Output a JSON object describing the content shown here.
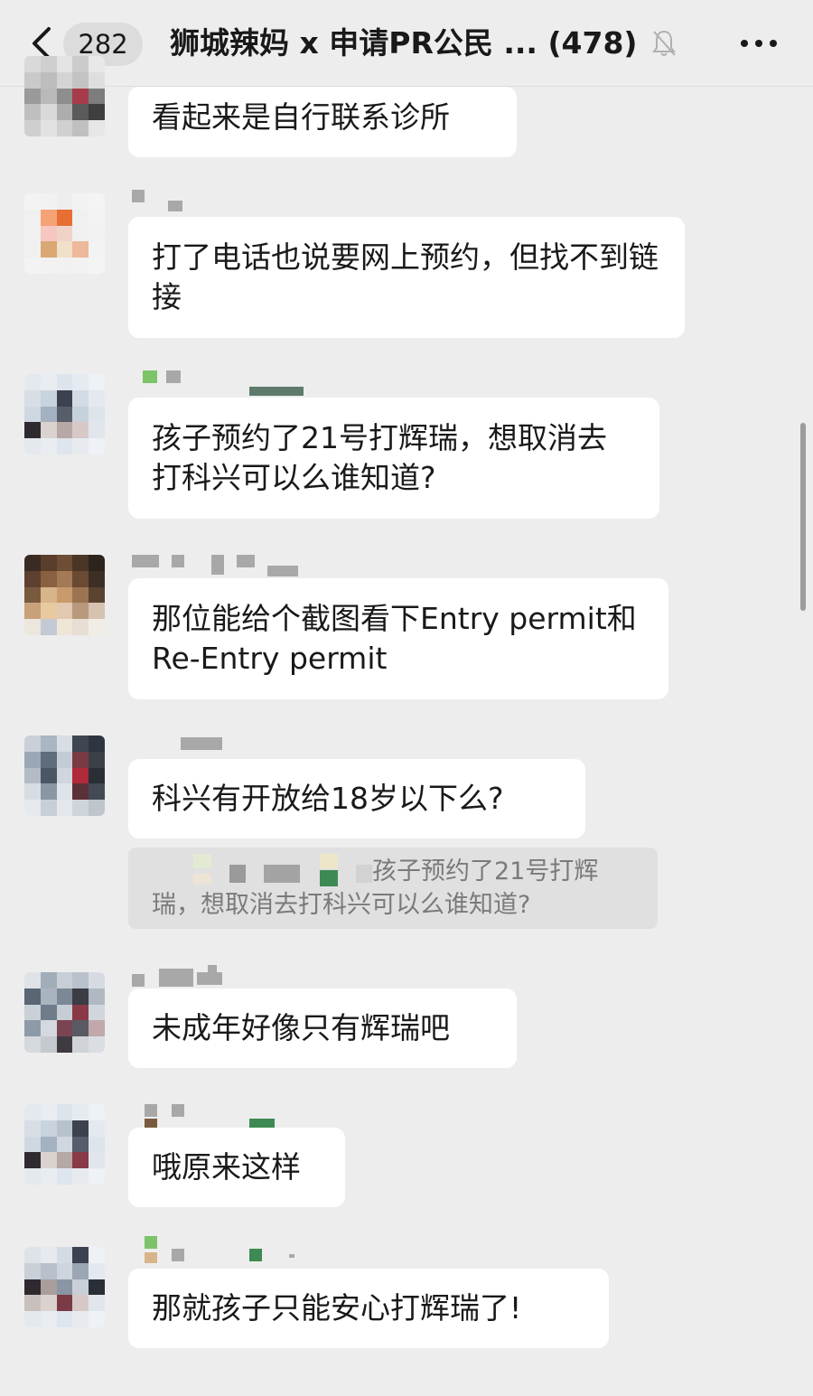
{
  "header": {
    "unread_count": "282",
    "chat_title": "狮城辣妈 x 申请PR公民 ... (478)",
    "back_icon": "chevron-left-icon",
    "mute_icon": "bell-muted-icon",
    "more_icon": "ellipsis-icon"
  },
  "messages": [
    {
      "text": "看起来是自行联系诊所"
    },
    {
      "text": "打了电话也说要网上预约，但找不到链接"
    },
    {
      "text": "孩子预约了21号打辉瑞，想取消去打科兴可以么谁知道?"
    },
    {
      "text": "那位能给个截图看下Entry permit和Re-Entry permit"
    },
    {
      "text": "科兴有开放给18岁以下么?"
    },
    {
      "text": "未成年好像只有辉瑞吧"
    },
    {
      "text": "哦原来这样"
    },
    {
      "text": "那就孩子只能安心打辉瑞了!"
    }
  ],
  "quote": {
    "text": "孩子预约了21号打辉瑞，想取消去打科兴可以么谁知道?"
  },
  "colors": {
    "background": "#ededed",
    "bubble": "#ffffff",
    "quote_bg": "#e0e0e0",
    "quote_text": "#7a7a7a"
  }
}
